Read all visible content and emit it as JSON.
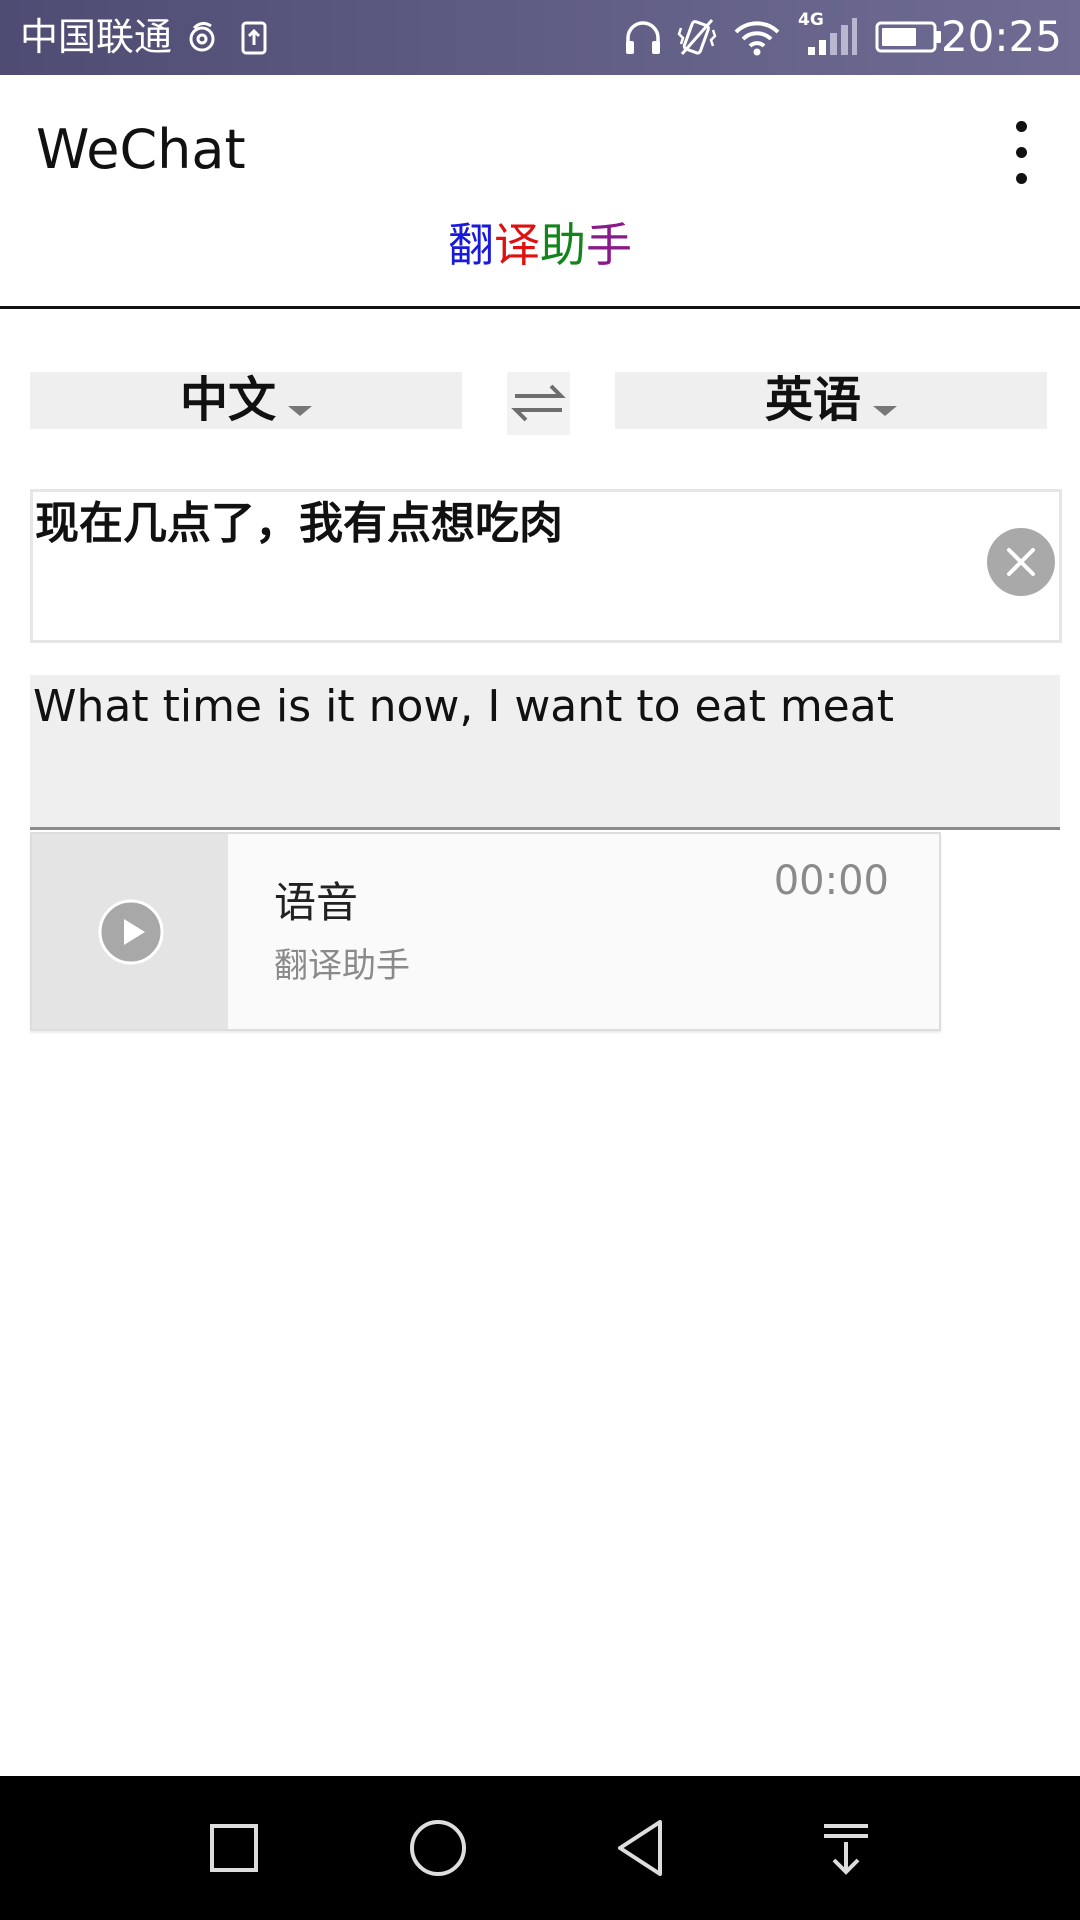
{
  "status_bar": {
    "carrier": "中国联通",
    "network": "4G",
    "time": "20:25",
    "icons": [
      "weibo-icon",
      "upload-icon",
      "headphones-icon",
      "vibrate-icon",
      "wifi-icon",
      "signal-icon",
      "battery-icon"
    ]
  },
  "header": {
    "app_title": "WeChat",
    "page_title": {
      "chars": [
        {
          "text": "翻",
          "color": "#1a1adb"
        },
        {
          "text": "译",
          "color": "#e01010"
        },
        {
          "text": "助",
          "color": "#12841a"
        },
        {
          "text": "手",
          "color": "#8a1a8a"
        }
      ]
    }
  },
  "translator": {
    "source_language": "中文",
    "target_language": "英语",
    "input_text": "现在几点了，我有点想吃肉",
    "output_text": "What time is it now, I want to eat meat"
  },
  "voice_card": {
    "title": "语音",
    "subtitle": "翻译助手",
    "duration": "00:00"
  },
  "nav_bar": {
    "buttons": [
      "recents-icon",
      "home-icon",
      "back-icon",
      "notification-pulldown-icon"
    ]
  }
}
